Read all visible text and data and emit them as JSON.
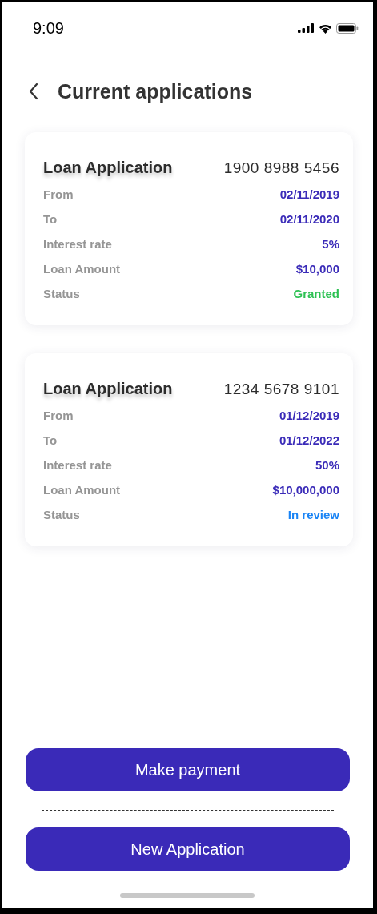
{
  "status_bar": {
    "time": "9:09"
  },
  "header": {
    "title": "Current applications"
  },
  "applications": [
    {
      "title": "Loan Application",
      "number": "1900 8988 5456",
      "fields": [
        {
          "label": "From",
          "value": "02/11/2019"
        },
        {
          "label": "To",
          "value": "02/11/2020"
        },
        {
          "label": "Interest rate",
          "value": "5%"
        },
        {
          "label": "Loan Amount",
          "value": "$10,000"
        },
        {
          "label": "Status",
          "value": "Granted",
          "color": "#2dc153"
        }
      ]
    },
    {
      "title": "Loan Application",
      "number": "1234 5678 9101",
      "fields": [
        {
          "label": "From",
          "value": "01/12/2019"
        },
        {
          "label": "To",
          "value": "01/12/2022"
        },
        {
          "label": "Interest rate",
          "value": "50%"
        },
        {
          "label": "Loan Amount",
          "value": "$10,000,000"
        },
        {
          "label": "Status",
          "value": "In review",
          "color": "#1a84f5"
        }
      ]
    }
  ],
  "buttons": [
    "Make payment",
    "New Application"
  ]
}
